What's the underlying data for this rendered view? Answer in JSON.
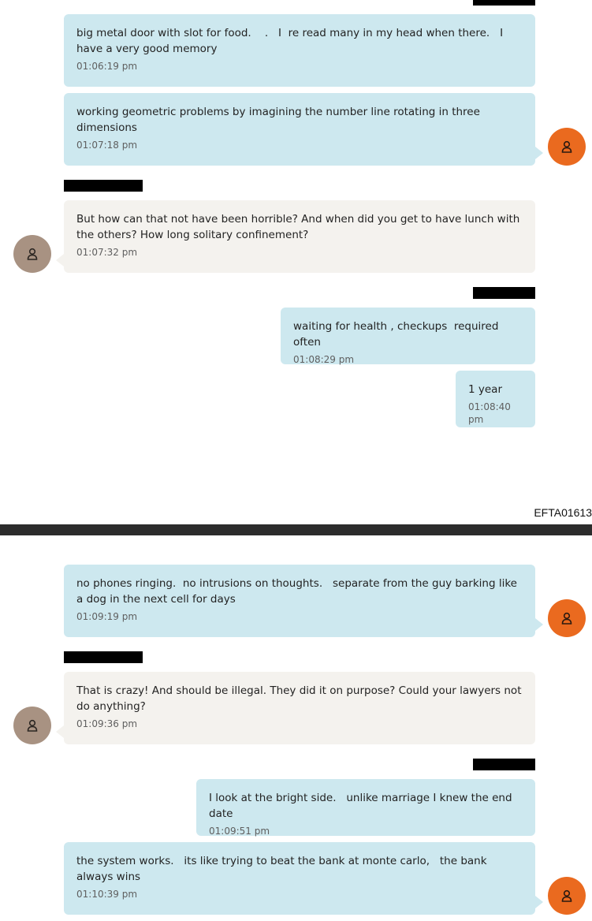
{
  "messages": [
    {
      "text": "big metal door with slot for food.    .   I  re read many in my head when there.   I have a very good memory",
      "time": "01:06:19 pm",
      "direction": "outgoing"
    },
    {
      "text": "working geometric problems by imagining the number line rotating in three dimensions",
      "time": "01:07:18 pm",
      "direction": "outgoing"
    },
    {
      "text": "But how can that not have been horrible? And when did you get to have lunch with the others? How long solitary confinement?",
      "time": "01:07:32 pm",
      "direction": "incoming"
    },
    {
      "text": "waiting for health , checkups  required  often",
      "time": "01:08:29 pm",
      "direction": "outgoing"
    },
    {
      "text": "1 year",
      "time": "01:08:40 pm",
      "direction": "outgoing"
    },
    {
      "text": "no phones ringing.  no intrusions on thoughts.   separate from the guy barking like a dog in the next cell for days",
      "time": "01:09:19 pm",
      "direction": "outgoing"
    },
    {
      "text": "That is crazy! And should be illegal. They did it on purpose? Could your lawyers not do anything?",
      "time": "01:09:36 pm",
      "direction": "incoming"
    },
    {
      "text": "I look at the bright side.   unlike marriage I knew the end date",
      "time": "01:09:51 pm",
      "direction": "outgoing"
    },
    {
      "text": "the system works.   its like trying to beat the bank at monte carlo,   the bank always wins",
      "time": "01:10:39 pm",
      "direction": "outgoing"
    }
  ],
  "page_id": "EFTA01613",
  "icons": {
    "avatar": "user-icon"
  },
  "colors": {
    "outgoing_bubble": "#cde8ef",
    "incoming_bubble": "#f4f2ee",
    "sender_avatar": "#ea6a1f",
    "other_avatar": "#a89282",
    "redaction": "#000000"
  }
}
